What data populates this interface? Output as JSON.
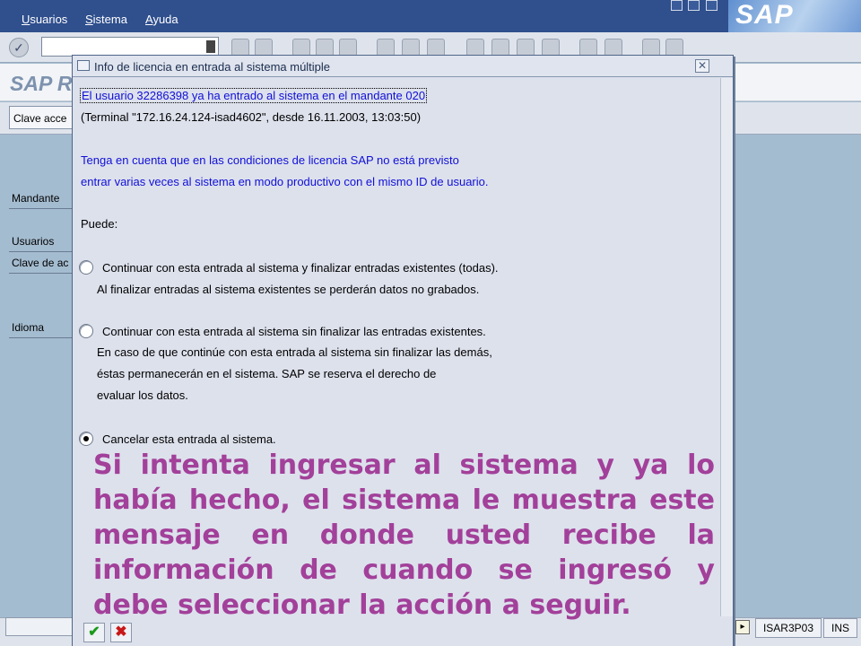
{
  "menubar": {
    "items": [
      "Usuarios",
      "Sistema",
      "Ayuda"
    ],
    "logo": "SAP"
  },
  "toolbar": {
    "command_field_value": ""
  },
  "main": {
    "title": "SAP R",
    "clave_button": "Clave acce",
    "fields": {
      "mandante": "Mandante",
      "usuarios": "Usuarios",
      "clave": "Clave de ac",
      "idioma": "Idioma"
    }
  },
  "dialog": {
    "title": "Info de licencia en entrada al sistema múltiple",
    "user_line": "El usuario 32286398 ya ha entrado al sistema en el mandante 020",
    "terminal_line": "(Terminal \"172.16.24.124-isad4602\", desde 16.11.2003, 13:03:50)",
    "notice_line1": "Tenga en cuenta que en las condiciones de licencia SAP no está previsto",
    "notice_line2": "entrar varias veces al sistema en modo productivo con el mismo ID de usuario.",
    "puede": "Puede:",
    "options": [
      {
        "label": "Continuar con esta entrada al sistema y finalizar entradas existentes (todas).",
        "details": [
          "Al finalizar entradas al sistema existentes se perderán datos no grabados."
        ],
        "selected": false
      },
      {
        "label": "Continuar con esta entrada al sistema sin finalizar las entradas existentes.",
        "details": [
          "En caso de que continúe con esta entrada al sistema sin finalizar las demás,",
          "éstas permanecerán en el sistema. SAP se reserva el derecho de",
          "evaluar los datos."
        ],
        "selected": false
      },
      {
        "label": "Cancelar esta entrada al sistema.",
        "details": [],
        "selected": true
      }
    ]
  },
  "overlay_text": "Si intenta ingresar al sistema y ya lo había hecho, el sistema le muestra este mensaje en donde usted recibe la información de cuando se ingresó y debe seleccionar la acción a seguir.",
  "statusbar": {
    "server": "ISAR3P03",
    "mode": "INS"
  },
  "colors": {
    "menubar": "#2f4f8d",
    "background": "#a4bcd0",
    "dialog_text_blue": "#1010d8",
    "overlay_text": "#a2409a"
  },
  "icons": {
    "enter": "check-circle-icon",
    "ok": "green-check-icon",
    "cancel": "red-x-icon",
    "close": "close-icon"
  }
}
